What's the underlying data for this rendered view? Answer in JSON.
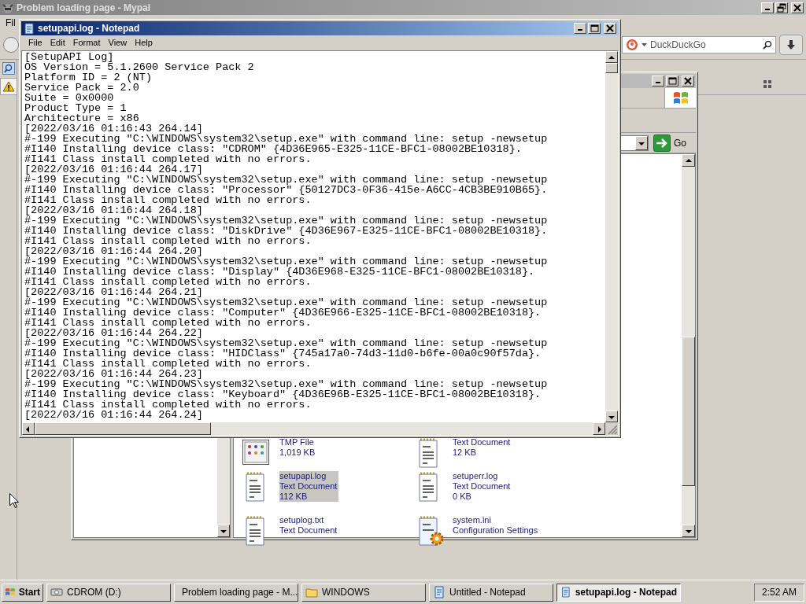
{
  "browser": {
    "title": "Problem loading page - Mypal",
    "menu": [
      "Fil"
    ],
    "search": {
      "placeholder": "DuckDuckGo"
    }
  },
  "explorer": {
    "go_button": "Go",
    "files": [
      {
        "kind": "tmp",
        "type": "TMP File",
        "size": "1,019 KB",
        "selected": false
      },
      {
        "kind": "text",
        "type": "Text Document",
        "size": "12 KB",
        "selected": false
      },
      {
        "kind": "text",
        "name": "setupapi.log",
        "type": "Text Document",
        "size": "112 KB",
        "selected": true
      },
      {
        "kind": "text",
        "name": "setuperr.log",
        "type": "Text Document",
        "size": "0 KB",
        "selected": false
      },
      {
        "kind": "text",
        "name": "setuplog.txt",
        "type": "Text Document",
        "selected": false
      },
      {
        "kind": "config",
        "name": "system.ini",
        "type": "Configuration Settings",
        "selected": false
      }
    ]
  },
  "notepad": {
    "title": "setupapi.log - Notepad",
    "menu": [
      "File",
      "Edit",
      "Format",
      "View",
      "Help"
    ],
    "lines": [
      "[SetupAPI Log]",
      "OS Version = 5.1.2600 Service Pack 2",
      "Platform ID = 2 (NT)",
      "Service Pack = 2.0",
      "Suite = 0x0000",
      "Product Type = 1",
      "Architecture = x86",
      "[2022/03/16 01:16:43 264.14]",
      "#-199 Executing \"C:\\WINDOWS\\system32\\setup.exe\" with command line: setup -newsetup",
      "#I140 Installing device class: \"CDROM\" {4D36E965-E325-11CE-BFC1-08002BE10318}.",
      "#I141 Class install completed with no errors.",
      "[2022/03/16 01:16:44 264.17]",
      "#-199 Executing \"C:\\WINDOWS\\system32\\setup.exe\" with command line: setup -newsetup",
      "#I140 Installing device class: \"Processor\" {50127DC3-0F36-415e-A6CC-4CB3BE910B65}.",
      "#I141 Class install completed with no errors.",
      "[2022/03/16 01:16:44 264.18]",
      "#-199 Executing \"C:\\WINDOWS\\system32\\setup.exe\" with command line: setup -newsetup",
      "#I140 Installing device class: \"DiskDrive\" {4D36E967-E325-11CE-BFC1-08002BE10318}.",
      "#I141 Class install completed with no errors.",
      "[2022/03/16 01:16:44 264.20]",
      "#-199 Executing \"C:\\WINDOWS\\system32\\setup.exe\" with command line: setup -newsetup",
      "#I140 Installing device class: \"Display\" {4D36E968-E325-11CE-BFC1-08002BE10318}.",
      "#I141 Class install completed with no errors.",
      "[2022/03/16 01:16:44 264.21]",
      "#-199 Executing \"C:\\WINDOWS\\system32\\setup.exe\" with command line: setup -newsetup",
      "#I140 Installing device class: \"Computer\" {4D36E966-E325-11CE-BFC1-08002BE10318}.",
      "#I141 Class install completed with no errors.",
      "[2022/03/16 01:16:44 264.22]",
      "#-199 Executing \"C:\\WINDOWS\\system32\\setup.exe\" with command line: setup -newsetup",
      "#I140 Installing device class: \"HIDClass\" {745a17a0-74d3-11d0-b6fe-00a0c90f57da}.",
      "#I141 Class install completed with no errors.",
      "[2022/03/16 01:16:44 264.23]",
      "#-199 Executing \"C:\\WINDOWS\\system32\\setup.exe\" with command line: setup -newsetup",
      "#I140 Installing device class: \"Keyboard\" {4D36E96B-E325-11CE-BFC1-08002BE10318}.",
      "#I141 Class install completed with no errors.",
      "[2022/03/16 01:16:44 264.24]"
    ]
  },
  "taskbar": {
    "start": "Start",
    "tasks": [
      {
        "kind": "drive",
        "label": "CDROM (D:)",
        "selected": false
      },
      {
        "kind": "browser",
        "label": "Problem loading page - M...",
        "selected": false
      },
      {
        "kind": "folder",
        "label": "WINDOWS",
        "selected": false
      },
      {
        "kind": "notepad",
        "label": "Untitled - Notepad",
        "selected": false
      },
      {
        "kind": "notepad",
        "label": "setupapi.log - Notepad",
        "selected": true
      }
    ],
    "clock": "2:52 AM"
  }
}
